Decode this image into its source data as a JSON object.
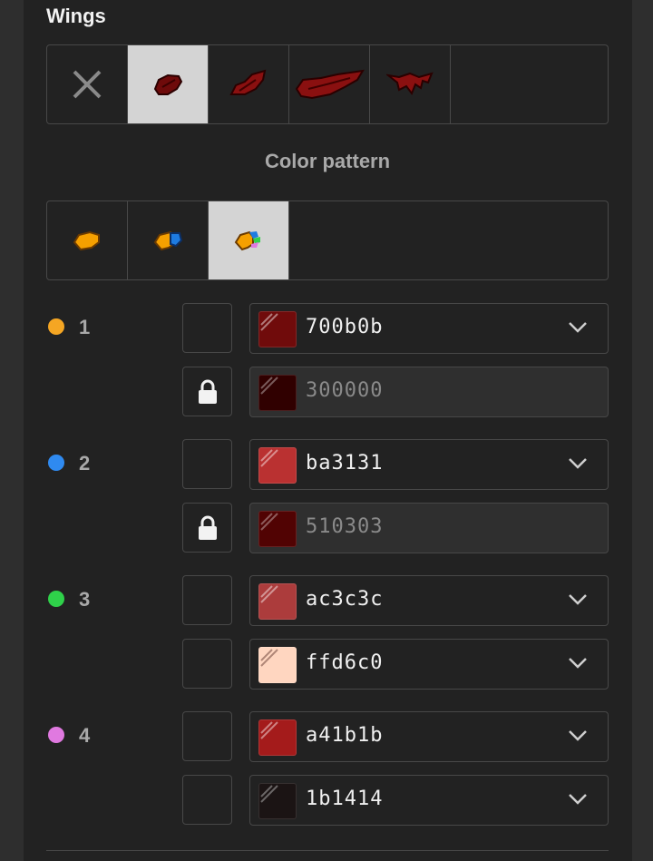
{
  "section_title": "Wings",
  "wing_options": [
    {
      "name": "none",
      "selected": false
    },
    {
      "name": "wing-small",
      "selected": true
    },
    {
      "name": "wing-medium",
      "selected": false
    },
    {
      "name": "wing-long",
      "selected": false
    },
    {
      "name": "wing-bat",
      "selected": false
    }
  ],
  "color_pattern_title": "Color pattern",
  "patterns": [
    {
      "name": "pattern-1",
      "selected": false
    },
    {
      "name": "pattern-2",
      "selected": false
    },
    {
      "name": "pattern-3",
      "selected": true
    }
  ],
  "channels": [
    {
      "number": "1",
      "dot_color": "#f5a623",
      "primary": {
        "hex": "700b0b",
        "color": "#700b0b",
        "locked": false
      },
      "secondary": {
        "hex": "300000",
        "color": "#300000",
        "locked": true
      }
    },
    {
      "number": "2",
      "dot_color": "#2f8af0",
      "primary": {
        "hex": "ba3131",
        "color": "#ba3131",
        "locked": false
      },
      "secondary": {
        "hex": "510303",
        "color": "#510303",
        "locked": true
      }
    },
    {
      "number": "3",
      "dot_color": "#2fd14a",
      "primary": {
        "hex": "ac3c3c",
        "color": "#ac3c3c",
        "locked": false
      },
      "secondary": {
        "hex": "ffd6c0",
        "color": "#ffd6c0",
        "locked": false
      }
    },
    {
      "number": "4",
      "dot_color": "#e079e0",
      "primary": {
        "hex": "a41b1b",
        "color": "#a41b1b",
        "locked": false
      },
      "secondary": {
        "hex": "1b1414",
        "color": "#1b1414",
        "locked": false
      }
    }
  ],
  "icons": {
    "lock": "lock-icon",
    "chevron": "chevron-down-icon",
    "none": "close-icon"
  }
}
